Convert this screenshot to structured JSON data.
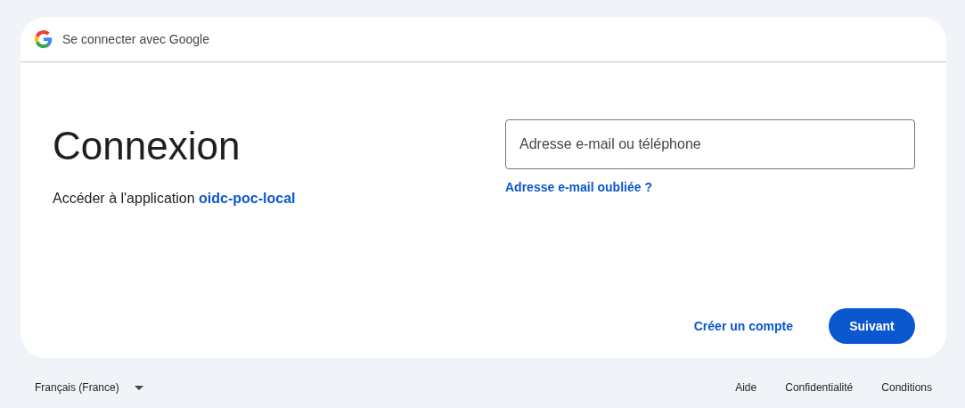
{
  "header": {
    "title": "Se connecter avec Google"
  },
  "heading": "Connexion",
  "subtitle": {
    "text": "Accéder à l'application ",
    "app_link": "oidc-poc-local"
  },
  "email_field": {
    "placeholder": "Adresse e-mail ou téléphone"
  },
  "forgot_link": "Adresse e-mail oubliée ?",
  "actions": {
    "create_account": "Créer un compte",
    "next": "Suivant"
  },
  "footer": {
    "language": "Français (France)",
    "links": [
      "Aide",
      "Confidentialité",
      "Conditions"
    ]
  }
}
